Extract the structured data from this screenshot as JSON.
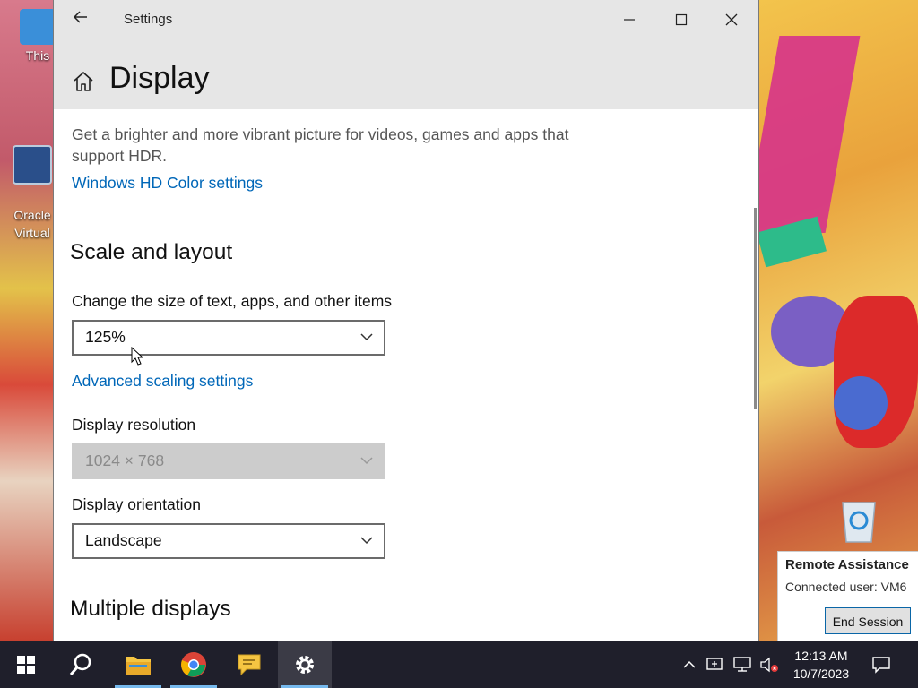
{
  "desktop": {
    "icons": [
      {
        "label": "This"
      },
      {
        "label": "Oracle\nVirtual"
      }
    ]
  },
  "window": {
    "title": "Settings",
    "page_title": "Display"
  },
  "content": {
    "hdr_description": "Get a brighter and more vibrant picture for videos, games and apps that support HDR.",
    "hdr_link": "Windows HD Color settings",
    "scale_section": "Scale and layout",
    "scale_label": "Change the size of text, apps, and other items",
    "scale_value": "125%",
    "advanced_scaling_link": "Advanced scaling settings",
    "resolution_label": "Display resolution",
    "resolution_value": "1024 × 768",
    "orientation_label": "Display orientation",
    "orientation_value": "Landscape",
    "multiple_section": "Multiple displays"
  },
  "remote_assistance": {
    "title": "Remote Assistance",
    "connected": "Connected user: VM6",
    "end_button": "End Session"
  },
  "taskbar": {
    "time": "12:13 AM",
    "date": "10/7/2023"
  },
  "colors": {
    "link": "#0067b8",
    "taskbar": "#1f1f2b",
    "titlebar": "#e6e6e6"
  }
}
